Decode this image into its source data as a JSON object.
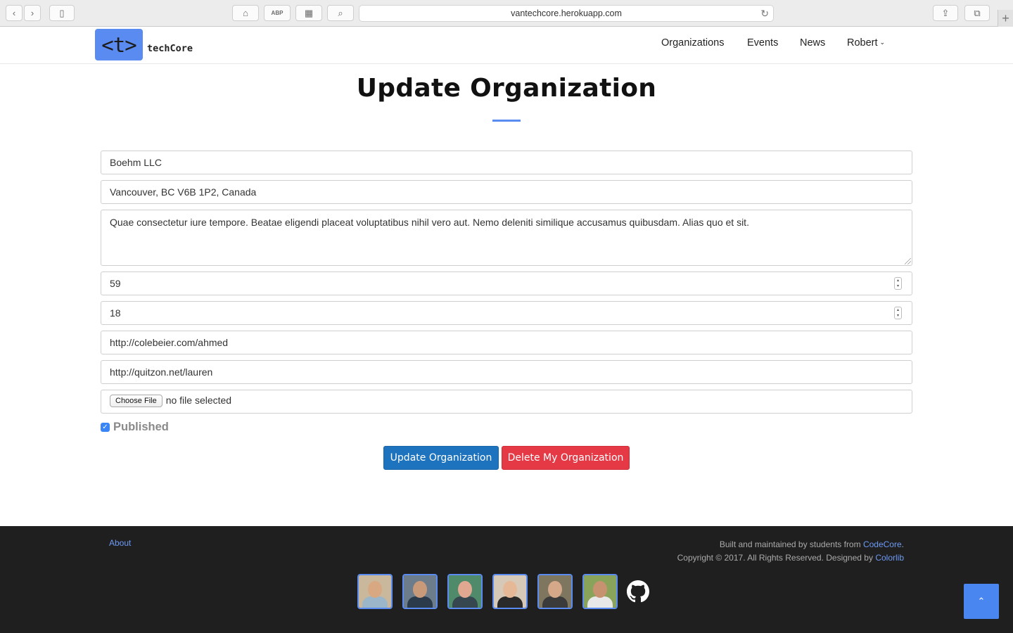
{
  "browser": {
    "url": "vantechcore.herokuapp.com"
  },
  "navbar": {
    "logo_mark": "<t>",
    "logo_text": "techCore",
    "items": [
      {
        "label": "Organizations"
      },
      {
        "label": "Events"
      },
      {
        "label": "News"
      },
      {
        "label": "Robert"
      }
    ]
  },
  "page": {
    "title": "Update Organization"
  },
  "form": {
    "name": "Boehm LLC",
    "address": "Vancouver, BC V6B 1P2, Canada",
    "description": "Quae consectetur iure tempore. Beatae eligendi placeat voluptatibus nihil vero aut. Nemo deleniti similique accusamus quibusdam. Alias quo et sit.",
    "number_1": "59",
    "number_2": "18",
    "url_1": "http://colebeier.com/ahmed",
    "url_2": "http://quitzon.net/lauren",
    "file_button": "Choose File",
    "file_status": "no file selected",
    "published_label": "Published",
    "published_checked": true,
    "update_button": "Update Organization",
    "delete_button": "Delete My Organization"
  },
  "footer": {
    "about": "About",
    "built_by": "Built and maintained by students from",
    "codecore": "CodeCore",
    "built_end": ".",
    "copyright": "Copyright © 2017. All Rights Reserved. Designed by",
    "colorlib": "Colorlib",
    "avatars": [
      {
        "bg": "#c9b89c",
        "face": "#d8a882",
        "body": "#9bb6c8"
      },
      {
        "bg": "#6c7c8a",
        "face": "#c99a7a",
        "body": "#2b3b4b"
      },
      {
        "bg": "#4f8a6a",
        "face": "#e0a890",
        "body": "#37474f"
      },
      {
        "bg": "#d7c9b8",
        "face": "#e5b898",
        "body": "#2a2a2a"
      },
      {
        "bg": "#7f7660",
        "face": "#d5a88a",
        "body": "#3b3b3b"
      },
      {
        "bg": "#8aa35a",
        "face": "#c79270",
        "body": "#e8e8e8"
      }
    ]
  },
  "colors": {
    "accent": "#5a8bf0",
    "primary_button": "#1e73be",
    "danger_button": "#e63946",
    "footer_bg": "#1f1f1f"
  }
}
